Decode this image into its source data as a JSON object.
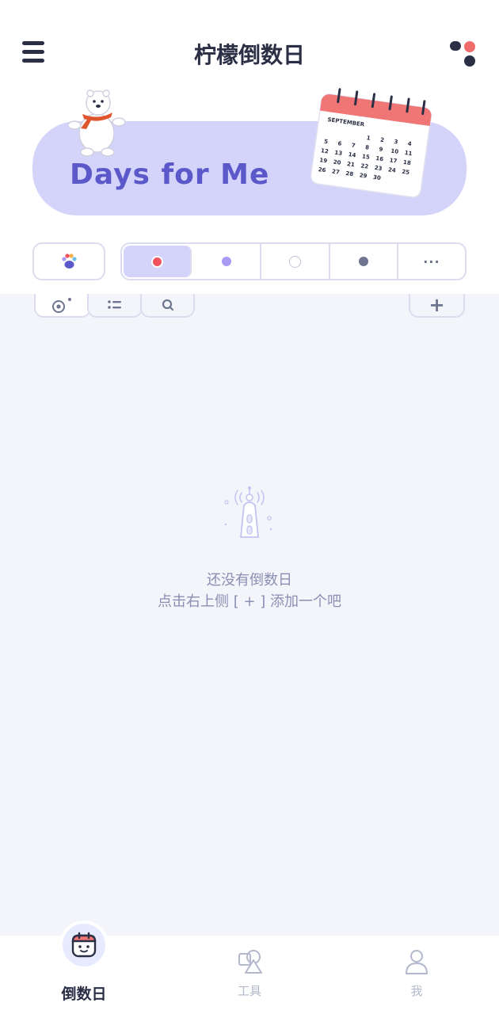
{
  "header": {
    "title": "柠檬倒数日",
    "menu_icon": "hamburger-menu-icon",
    "dots_icon": "dots-grid-icon"
  },
  "banner": {
    "text": "Days for Me",
    "calendar_month": "SEPTEMBER",
    "calendar_days": [
      "1",
      "2",
      "3",
      "4",
      "5",
      "6",
      "7",
      "8",
      "9",
      "10",
      "11",
      "12",
      "13",
      "14",
      "15",
      "16",
      "17",
      "18",
      "19",
      "20",
      "21",
      "22",
      "23",
      "24",
      "25",
      "26",
      "27",
      "28",
      "29",
      "30"
    ]
  },
  "filters": {
    "paw_icon": "paw-icon",
    "items": [
      {
        "name": "red",
        "color": "#f4515e",
        "active": true
      },
      {
        "name": "purple",
        "color": "#a99bf5",
        "active": false
      },
      {
        "name": "white",
        "color": "#ffffff",
        "active": false
      },
      {
        "name": "gray",
        "color": "#6e7590",
        "active": false
      },
      {
        "name": "more",
        "label": "···",
        "active": false
      }
    ]
  },
  "tabs": {
    "items": [
      "target-icon",
      "list-icon",
      "search-icon"
    ],
    "add_label": "+"
  },
  "empty_state": {
    "line1": "还没有倒数日",
    "line2": "点击右上侧 [ + ] 添加一个吧"
  },
  "bottom_nav": {
    "items": [
      {
        "label": "倒数日",
        "icon": "calendar-face-icon",
        "active": true
      },
      {
        "label": "工具",
        "icon": "tools-icon",
        "active": false
      },
      {
        "label": "我",
        "icon": "person-icon",
        "active": false
      }
    ]
  },
  "colors": {
    "accent": "#5b58c9",
    "banner_bg": "#d4d4fb",
    "content_bg": "#f4f5fb"
  }
}
